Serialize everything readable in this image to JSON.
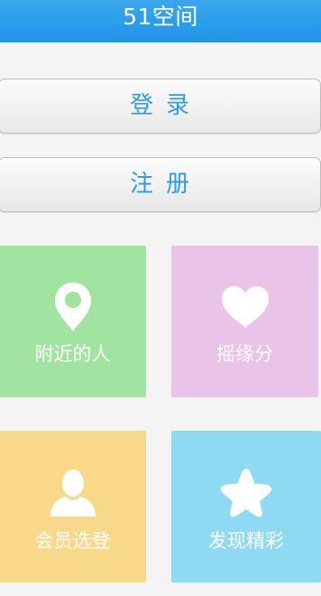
{
  "header": {
    "title": "51空间"
  },
  "auth": {
    "login_label": "登录",
    "register_label": "注册"
  },
  "tiles": [
    {
      "label": "附近的人",
      "icon": "location-pin-icon",
      "color": "#a0e4a0"
    },
    {
      "label": "摇缘分",
      "icon": "heart-icon",
      "color": "#e9c3e8"
    },
    {
      "label": "会员选登",
      "icon": "person-icon",
      "color": "#f8d98a"
    },
    {
      "label": "发现精彩",
      "icon": "star-icon",
      "color": "#8fdaf3"
    }
  ],
  "colors": {
    "header": "#1f95e6",
    "button_text": "#2f9be0"
  }
}
